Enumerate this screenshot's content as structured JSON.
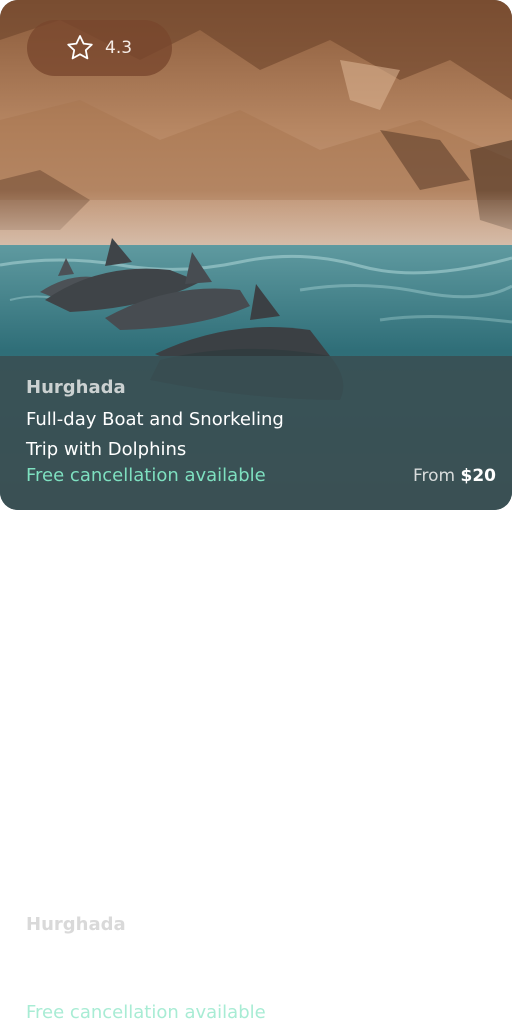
{
  "card": {
    "rating": "4.3",
    "location": "Hurghada",
    "title_line1": "Full-day Boat and Snorkeling",
    "title_line2": "Trip with Dolphins",
    "cancellation": "Free cancellation available",
    "price_prefix": "From ",
    "price_amount": "$20",
    "image": "dolphins-swimming-by-rocky-coast"
  },
  "ghost_card": {
    "location": "Hurghada",
    "cancellation": "Free cancellation available"
  },
  "colors": {
    "accent_green": "#7ee0c0",
    "badge_bg": "#784629",
    "panel_bg": "#3a4e52"
  },
  "icons": {
    "rating": "star-icon"
  }
}
